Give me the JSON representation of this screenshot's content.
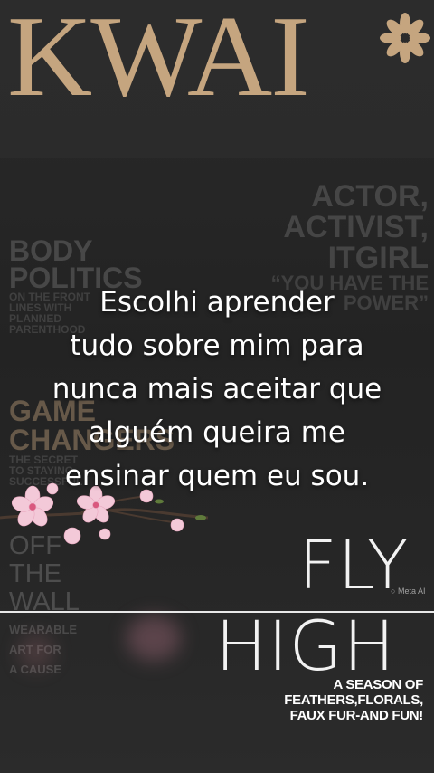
{
  "cover": {
    "masthead": "KWAI",
    "right_headline": [
      "ACTOR,",
      "ACTIVIST,",
      "ITGIRL"
    ],
    "right_quote": [
      "“YOU HAVE THE",
      "POWER”"
    ],
    "body_politics": {
      "title": [
        "BODY",
        "POLITICS"
      ],
      "subtitle": [
        "ON THE FRONT",
        "LINES WITH",
        "PLANNED",
        "PARENTHOOD"
      ]
    },
    "game_changers": {
      "title": [
        "GAME",
        "CHANGERS"
      ],
      "subtitle": [
        "THE SECRET",
        "TO STAYING",
        "SUCCESSFUL"
      ]
    },
    "off_the_wall": {
      "title": [
        "OFF",
        "THE",
        "WALL"
      ],
      "subtitle": [
        "WEARABLE",
        "ART FOR",
        "A CAUSE"
      ]
    },
    "fly": "FLY",
    "high": "HIGH",
    "tagline": [
      "A SEASON OF",
      "FEATHERS,FLORALS,",
      "FAUX FUR-AND FUN!"
    ],
    "watermark": "Meta AI",
    "accent_gold": "#c5a57f"
  },
  "overlay": {
    "lines": [
      "Escolhi aprender",
      "tudo sobre mim para",
      "nunca mais aceitar que",
      "alguém queira me",
      "ensinar quem eu sou."
    ]
  }
}
